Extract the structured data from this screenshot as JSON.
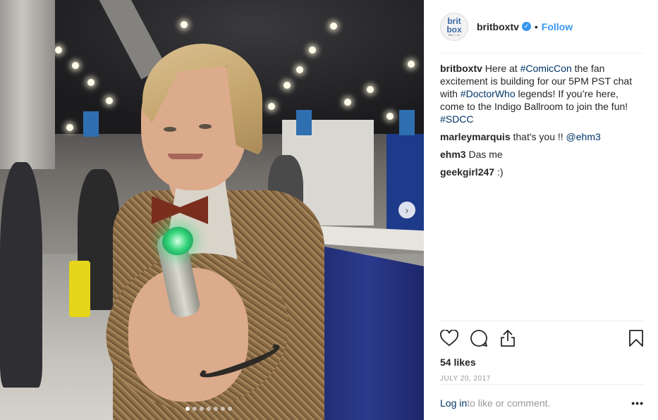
{
  "post": {
    "username": "britboxtv",
    "avatar_text": [
      "brit",
      "box",
      "BBC + itv"
    ],
    "separator": "•",
    "follow_label": "Follow",
    "verified_icon": "✓",
    "caption_user": "britboxtv",
    "caption_parts": [
      {
        "text": " Here at ",
        "tag": false
      },
      {
        "text": "#ComicCon",
        "tag": true
      },
      {
        "text": " the fan excitement is building for our 5PM PST chat with ",
        "tag": false
      },
      {
        "text": "#DoctorWho",
        "tag": true
      },
      {
        "text": " legends! If you’re here, come to the Indigo Ballroom to join the fun! ",
        "tag": false
      },
      {
        "text": "#SDCC",
        "tag": true
      }
    ],
    "comments": [
      {
        "user": "marleymarquis",
        "text": " that's you !! ",
        "mention": "@ehm3"
      },
      {
        "user": "ehm3",
        "text": " Das me",
        "mention": ""
      },
      {
        "user": "geekgirl247",
        "text": " :)",
        "mention": ""
      }
    ],
    "likes": "54 likes",
    "date": "JULY 20, 2017",
    "login_link": "Log in",
    "login_text": " to like or comment.",
    "more_label": "•••",
    "next_glyph": "›",
    "carousel": {
      "count": 7,
      "active": 0
    }
  },
  "colors": {
    "link": "#3897f0",
    "tag": "#003569",
    "muted": "#999999"
  }
}
